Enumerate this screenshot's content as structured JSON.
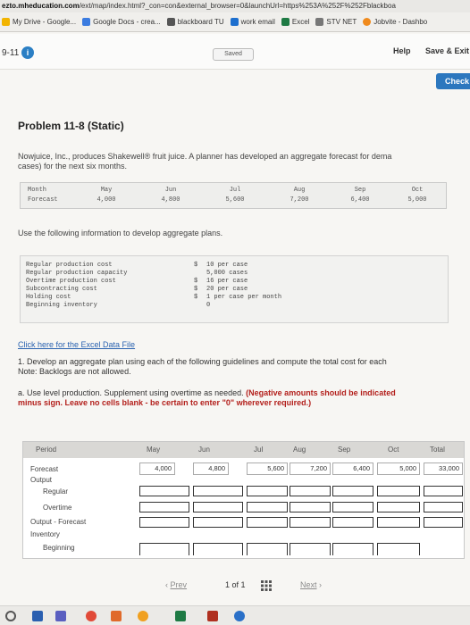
{
  "browser": {
    "url_prefix": "ezto.mheducation.com",
    "url_rest": "/ext/map/index.html?_con=con&external_browser=0&launchUrl=https%253A%252F%252Fblackboa",
    "bookmarks": [
      {
        "label": "My Drive - Google...",
        "color": "#f2b400"
      },
      {
        "label": "Google Docs - crea...",
        "color": "#3b7ce0"
      },
      {
        "label": "blackboard TU",
        "color": "#555555"
      },
      {
        "label": "work email",
        "color": "#1d6fce"
      },
      {
        "label": "Excel",
        "color": "#1e7a44"
      },
      {
        "label": "STV NET",
        "color": "#777777"
      },
      {
        "label": "Jobvite - Dashbo",
        "color": "#f08a1c"
      }
    ]
  },
  "topbar": {
    "question_number": "9-11",
    "saved_label": "Saved",
    "help_label": "Help",
    "save_exit_label": "Save & Exit",
    "check_label": "Check"
  },
  "problem": {
    "title": "Problem 11-8 (Static)",
    "intro_line1": "Nowjuice, Inc., produces Shakewell® fruit juice. A planner has developed an aggregate forecast for dema",
    "intro_line2": "cases) for the next six months.",
    "forecast_table": {
      "row1": [
        "Month",
        "May",
        "Jun",
        "Jul",
        "Aug",
        "Sep",
        "Oct"
      ],
      "row2": [
        "Forecast",
        "4,000",
        "4,800",
        "5,600",
        "7,200",
        "6,400",
        "5,000"
      ]
    },
    "use_following": "Use the following information to develop aggregate plans.",
    "costs": [
      {
        "label": "Regular production cost",
        "dollar": "$",
        "value": "10 per case"
      },
      {
        "label": "Regular production capacity",
        "dollar": "",
        "value": "5,000 cases"
      },
      {
        "label": "Overtime production cost",
        "dollar": "$",
        "value": "16 per case"
      },
      {
        "label": "Subcontracting cost",
        "dollar": "$",
        "value": "20 per case"
      },
      {
        "label": "Holding cost",
        "dollar": "$",
        "value": "1 per case per month"
      },
      {
        "label": "Beginning inventory",
        "dollar": "",
        "value": "0"
      }
    ],
    "excel_link": "Click here for the Excel Data File",
    "q1_line1": "1. Develop an aggregate plan using each of the following guidelines and compute the total cost for each",
    "q1_line2": "Note: Backlogs are not allowed.",
    "qa_prefix": "a. Use level production. Supplement using overtime as needed.",
    "qa_bold1": "(Negative amounts should be indicated",
    "qa_bold2": "minus sign. Leave no cells blank - be certain to enter \"0\" wherever required.)"
  },
  "grid": {
    "headers": [
      "Period",
      "May",
      "Jun",
      "Jul",
      "Aug",
      "Sep",
      "Oct",
      "Total"
    ],
    "rows": {
      "forecast": "Forecast",
      "output": "Output",
      "regular": "Regular",
      "overtime": "Overtime",
      "output_forecast": "Output - Forecast",
      "inventory": "Inventory",
      "beginning": "Beginning"
    },
    "forecast_values": [
      "4,000",
      "4,800",
      "5,600",
      "7,200",
      "6,400",
      "5,000",
      "33,000"
    ]
  },
  "pager": {
    "prev_label": "Prev",
    "page_text": "1 of 1",
    "next_label": "Next"
  }
}
